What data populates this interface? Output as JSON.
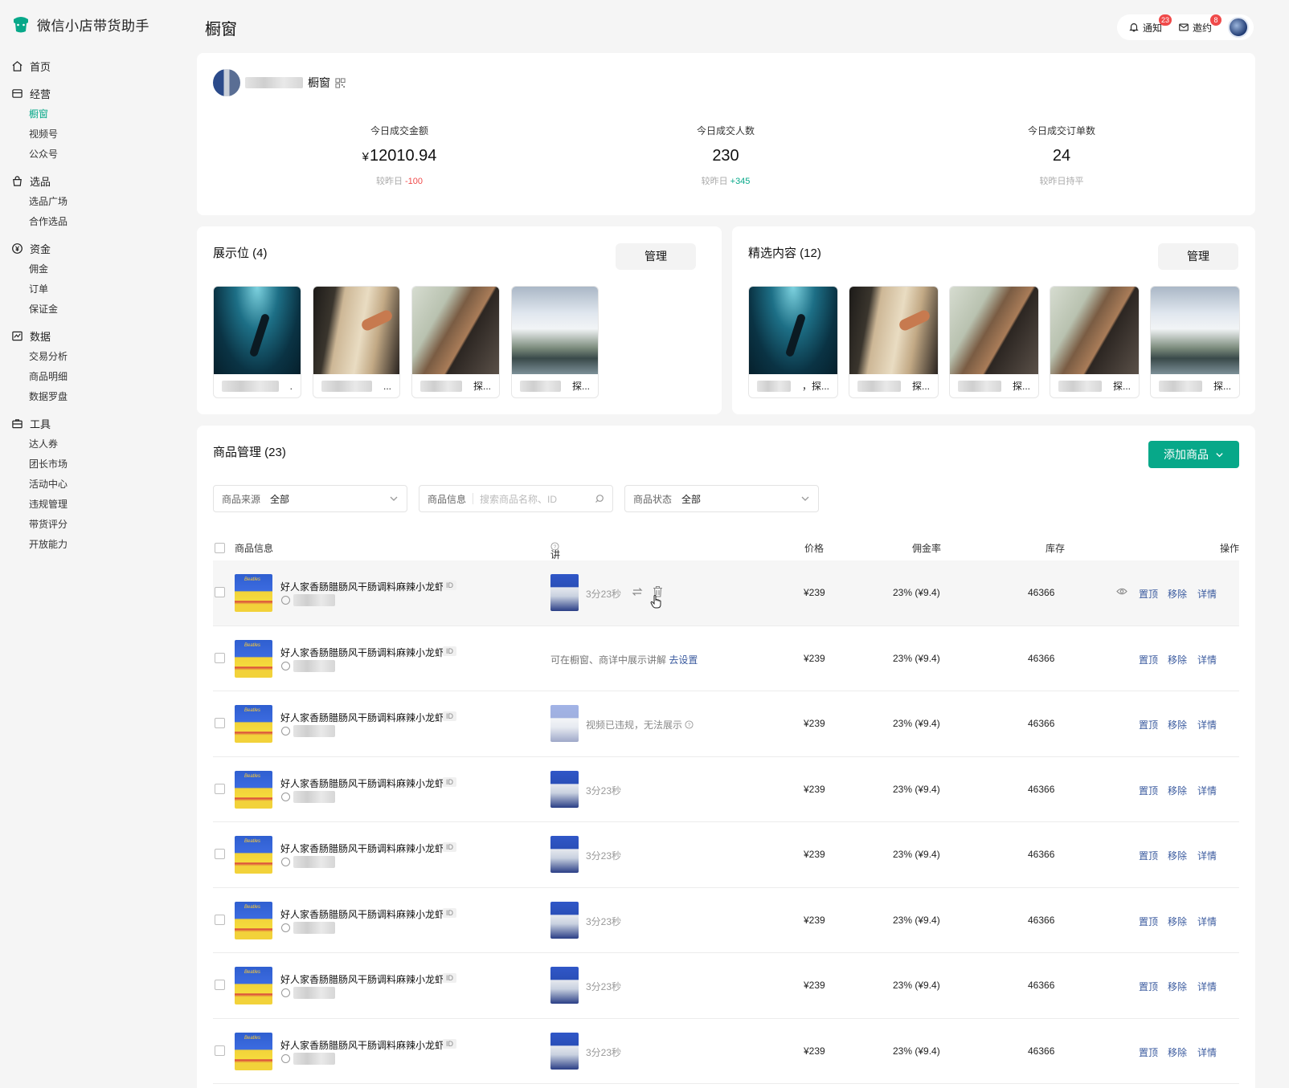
{
  "brand": {
    "name": "微信小店带货助手"
  },
  "page": {
    "title": "橱窗"
  },
  "topbar": {
    "notify_label": "通知",
    "notify_count": "23",
    "invite_label": "邀约",
    "invite_count": "8"
  },
  "nav": {
    "home": "首页",
    "operate": {
      "label": "经营",
      "items": [
        "橱窗",
        "视频号",
        "公众号"
      ]
    },
    "select": {
      "label": "选品",
      "items": [
        "选品广场",
        "合作选品"
      ]
    },
    "funds": {
      "label": "资金",
      "items": [
        "佣金",
        "订单",
        "保证金"
      ]
    },
    "data": {
      "label": "数据",
      "items": [
        "交易分析",
        "商品明细",
        "数据罗盘"
      ]
    },
    "tools": {
      "label": "工具",
      "items": [
        "达人券",
        "团长市场",
        "活动中心",
        "违规管理",
        "带货评分",
        "开放能力"
      ]
    }
  },
  "shop": {
    "name": "橱窗"
  },
  "stats": {
    "amount": {
      "label": "今日成交金额",
      "currency": "¥",
      "value": "12010.94",
      "delta_prefix": "较昨日",
      "delta": "-100"
    },
    "buyers": {
      "label": "今日成交人数",
      "value": "230",
      "delta_prefix": "较昨日",
      "delta": "+345"
    },
    "orders": {
      "label": "今日成交订单数",
      "value": "24",
      "delta_text": "较昨日持平"
    }
  },
  "showcase": {
    "title": "展示位 (4)",
    "manage": "管理",
    "items": [
      {
        "caption": "."
      },
      {
        "caption": "..."
      },
      {
        "caption": "探..."
      },
      {
        "caption": "探..."
      }
    ]
  },
  "selected": {
    "title": "精选内容 (12)",
    "manage": "管理",
    "items": [
      {
        "caption": "，探..."
      },
      {
        "caption": "探..."
      },
      {
        "caption": "探..."
      },
      {
        "caption": "探..."
      },
      {
        "caption": "探..."
      }
    ]
  },
  "products": {
    "title": "商品管理 (23)",
    "add_button": "添加商品",
    "filters": {
      "source_label": "商品来源",
      "source_value": "全部",
      "info_label": "商品信息",
      "info_placeholder": "搜索商品名称、ID",
      "status_label": "商品状态",
      "status_value": "全部"
    },
    "columns": {
      "info": "商品信息",
      "replay": "讲解回放",
      "price": "价格",
      "rate": "佣金率",
      "stock": "库存",
      "ops": "操作"
    },
    "id_tag": "ID",
    "op_top": "置顶",
    "op_remove": "移除",
    "op_detail": "详情",
    "note_available": "可在橱窗、商详中展示讲解",
    "note_link": "去设置",
    "note_violation": "视频已违规，无法展示",
    "rows": [
      {
        "name": "好人家香肠腊肠风干肠调料麻辣小龙虾",
        "replay": "3分23秒",
        "price": "¥239",
        "rate": "23% (¥9.4)",
        "stock": "46366"
      },
      {
        "name": "好人家香肠腊肠风干肠调料麻辣小龙虾",
        "replay": "",
        "price": "¥239",
        "rate": "23% (¥9.4)",
        "stock": "46366"
      },
      {
        "name": "好人家香肠腊肠风干肠调料麻辣小龙虾",
        "replay": "",
        "price": "¥239",
        "rate": "23% (¥9.4)",
        "stock": "46366"
      },
      {
        "name": "好人家香肠腊肠风干肠调料麻辣小龙虾",
        "replay": "3分23秒",
        "price": "¥239",
        "rate": "23% (¥9.4)",
        "stock": "46366"
      },
      {
        "name": "好人家香肠腊肠风干肠调料麻辣小龙虾",
        "replay": "3分23秒",
        "price": "¥239",
        "rate": "23% (¥9.4)",
        "stock": "46366"
      },
      {
        "name": "好人家香肠腊肠风干肠调料麻辣小龙虾",
        "replay": "3分23秒",
        "price": "¥239",
        "rate": "23% (¥9.4)",
        "stock": "46366"
      },
      {
        "name": "好人家香肠腊肠风干肠调料麻辣小龙虾",
        "replay": "3分23秒",
        "price": "¥239",
        "rate": "23% (¥9.4)",
        "stock": "46366"
      },
      {
        "name": "好人家香肠腊肠风干肠调料麻辣小龙虾",
        "replay": "3分23秒",
        "price": "¥239",
        "rate": "23% (¥9.4)",
        "stock": "46366"
      }
    ]
  },
  "colors": {
    "accent": "#07a889",
    "danger": "#f04a4a",
    "link": "#3a5a9e"
  }
}
